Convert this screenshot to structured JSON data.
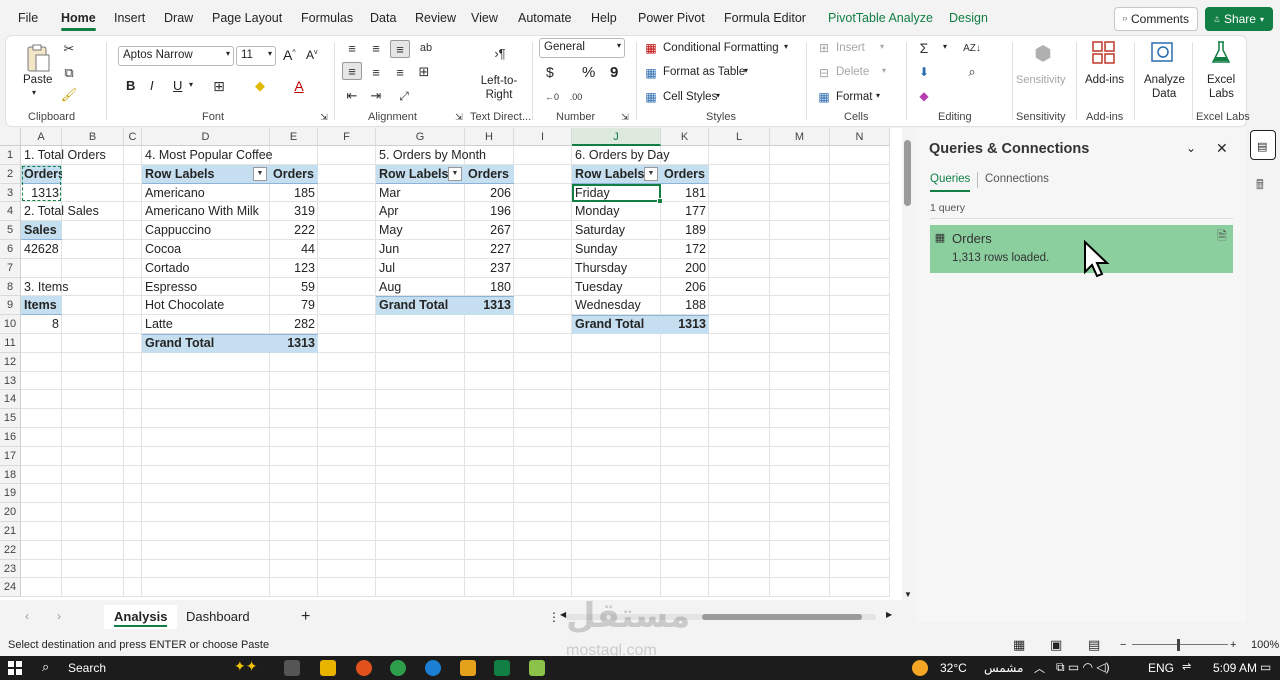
{
  "menu": {
    "tabs": [
      "File",
      "Home",
      "Insert",
      "Draw",
      "Page Layout",
      "Formulas",
      "Data",
      "Review",
      "View",
      "Automate",
      "Help",
      "Power Pivot",
      "Formula Editor",
      "PivotTable Analyze",
      "Design"
    ],
    "active": "Home",
    "comments": "Comments",
    "share": "Share"
  },
  "ribbon": {
    "clipboard": {
      "paste": "Paste",
      "label": "Clipboard"
    },
    "font": {
      "name": "Aptos Narrow",
      "size": "11",
      "label": "Font",
      "bold": "B",
      "italic": "I",
      "underline": "U"
    },
    "alignment": {
      "ltr": "Left-to-Right",
      "label": "Alignment",
      "textdir": "Text Direct..."
    },
    "number": {
      "format": "General",
      "currency": "$",
      "percent": "%",
      "comma": "9",
      "label": "Number"
    },
    "styles": {
      "cond": "Conditional Formatting",
      "table": "Format as Table",
      "cell": "Cell Styles",
      "label": "Styles"
    },
    "cells": {
      "insert": "Insert",
      "delete": "Delete",
      "format": "Format",
      "label": "Cells"
    },
    "editing": {
      "label": "Editing"
    },
    "sensitivity": {
      "btn": "Sensitivity",
      "label": "Sensitivity"
    },
    "addins": {
      "btn": "Add-ins",
      "label": "Add-ins"
    },
    "analyze": {
      "l1": "Analyze",
      "l2": "Data"
    },
    "labs": {
      "l1": "Excel",
      "l2": "Labs",
      "label": "Excel Labs"
    }
  },
  "sheet": {
    "columns": [
      "A",
      "B",
      "C",
      "D",
      "E",
      "F",
      "G",
      "H",
      "I",
      "J",
      "K",
      "L",
      "M",
      "N"
    ],
    "selected_col": "J",
    "rows": [
      "1",
      "2",
      "3",
      "4",
      "5",
      "6",
      "7",
      "8",
      "9",
      "10",
      "11",
      "12",
      "13",
      "14",
      "15",
      "16",
      "17",
      "18",
      "19",
      "20",
      "21",
      "22",
      "23",
      "24"
    ],
    "t1": {
      "title": "1. Total Orders",
      "header": "Orders",
      "value": "1313"
    },
    "t2": {
      "title": "2. Total Sales",
      "header": "Sales",
      "value": "42628"
    },
    "t3": {
      "title": "3. Items",
      "header": "Items",
      "value": "8"
    },
    "t4": {
      "title": "4. Most Popular Coffee",
      "h1": "Row Labels",
      "h2": "Orders",
      "rows": [
        [
          "Americano",
          "185"
        ],
        [
          "Americano With Milk",
          "319"
        ],
        [
          "Cappuccino",
          "222"
        ],
        [
          "Cocoa",
          "44"
        ],
        [
          "Cortado",
          "123"
        ],
        [
          "Espresso",
          "59"
        ],
        [
          "Hot Chocolate",
          "79"
        ],
        [
          "Latte",
          "282"
        ]
      ],
      "total": [
        "Grand Total",
        "1313"
      ]
    },
    "t5": {
      "title": "5. Orders by Month",
      "h1": "Row Labels",
      "h2": "Orders",
      "rows": [
        [
          "Mar",
          "206"
        ],
        [
          "Apr",
          "196"
        ],
        [
          "May",
          "267"
        ],
        [
          "Jun",
          "227"
        ],
        [
          "Jul",
          "237"
        ],
        [
          "Aug",
          "180"
        ]
      ],
      "total": [
        "Grand Total",
        "1313"
      ]
    },
    "t6": {
      "title": "6. Orders by Day",
      "h1": "Row Labels",
      "h2": "Orders",
      "rows": [
        [
          "Friday",
          "181"
        ],
        [
          "Monday",
          "177"
        ],
        [
          "Saturday",
          "189"
        ],
        [
          "Sunday",
          "172"
        ],
        [
          "Thursday",
          "200"
        ],
        [
          "Tuesday",
          "206"
        ],
        [
          "Wednesday",
          "188"
        ]
      ],
      "total": [
        "Grand Total",
        "1313"
      ]
    }
  },
  "tabs": {
    "sheets": [
      "Analysis",
      "Dashboard"
    ],
    "active": "Analysis",
    "add": "+"
  },
  "status": {
    "message": "Select destination and press ENTER or choose Paste",
    "zoom": "100%"
  },
  "queries": {
    "title": "Queries & Connections",
    "tab1": "Queries",
    "tab2": "Connections",
    "count": "1 query",
    "item_name": "Orders",
    "item_status": "1,313 rows loaded."
  },
  "watermark": {
    "brand": "مستقل",
    "url": "mostaql.com"
  },
  "taskbar": {
    "search": "Search",
    "temp": "32°C",
    "weather": "مشمس",
    "lang": "ENG",
    "time": "5:09 AM"
  },
  "colors": {
    "accent": "#117e43",
    "pivot": "#c6dff0",
    "query": "#8ccf9f"
  }
}
